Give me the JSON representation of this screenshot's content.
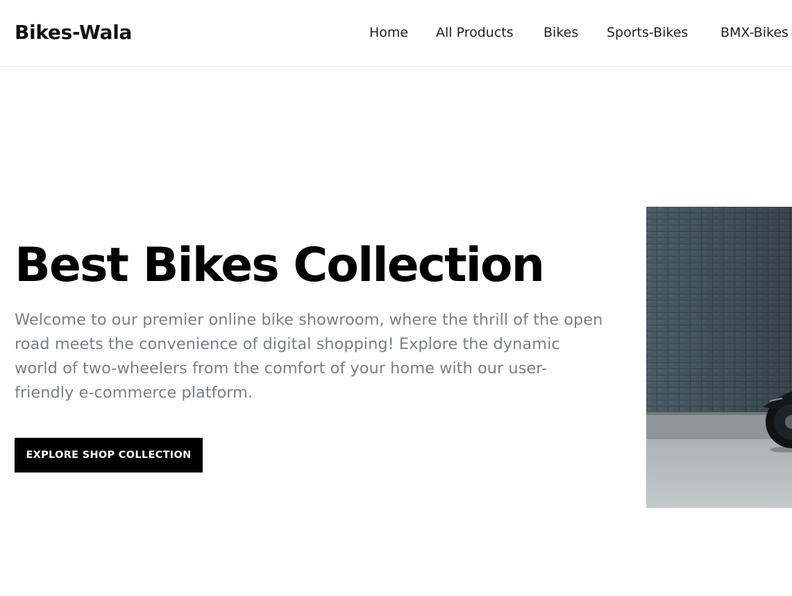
{
  "header": {
    "brand": "Bikes-Wala",
    "nav": [
      {
        "label": "Home"
      },
      {
        "label": "All Products"
      },
      {
        "label": "Bikes"
      },
      {
        "label": "Sports-Bikes"
      },
      {
        "label": "BMX-Bikes"
      }
    ]
  },
  "hero": {
    "title": "Best Bikes Collection",
    "description": "Welcome to our premier online bike showroom, where the thrill of the open road meets the convenience of digital shopping! Explore the dynamic world of two-wheelers from the comfort of your home with our user-friendly e-commerce platform.",
    "cta_label": "EXPLORE SHOP COLLECTION"
  },
  "colors": {
    "text_primary": "#000000",
    "text_muted": "#7b7f85",
    "button_bg": "#000000",
    "button_text": "#ffffff",
    "border": "#e6e6e6"
  },
  "icons": {
    "hero_image": "motorcycle-photo"
  }
}
